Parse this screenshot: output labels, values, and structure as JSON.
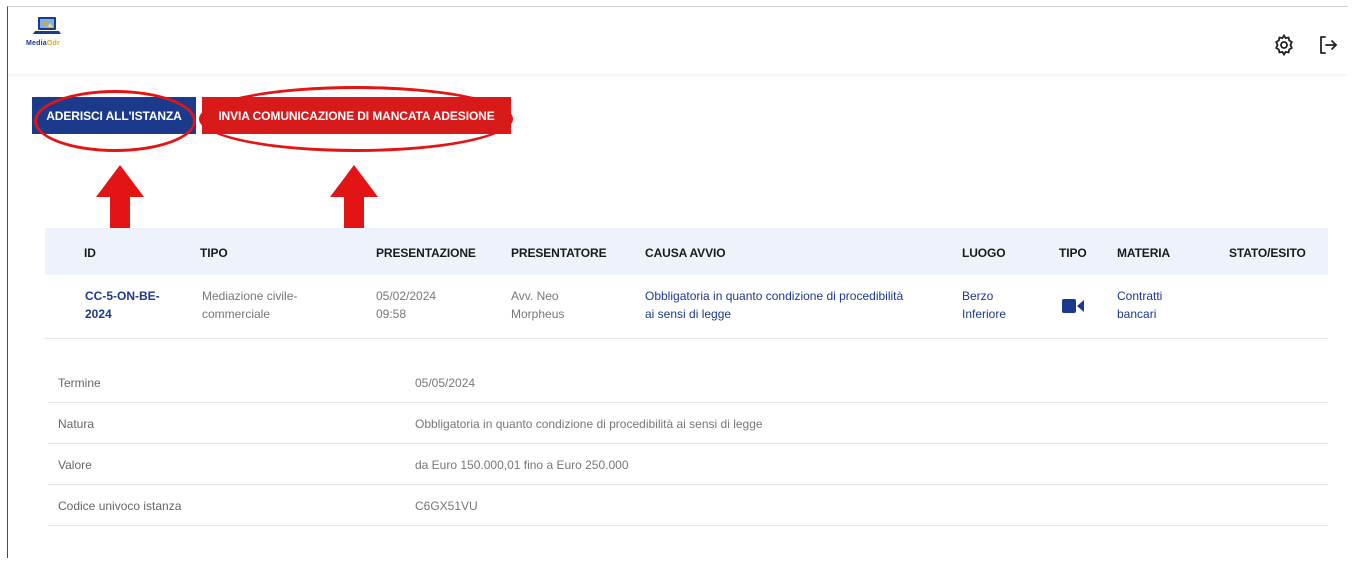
{
  "header": {
    "logo_text_main": "Media",
    "logo_text_accent": "Odr"
  },
  "actions": {
    "adhere_label": "ADERISCI ALL'ISTANZA",
    "decline_label": "INVIA COMUNICAZIONE DI MANCATA ADESIONE"
  },
  "table": {
    "headers": [
      "ID",
      "TIPO",
      "PRESENTAZIONE",
      "PRESENTATORE",
      "CAUSA AVVIO",
      "LUOGO",
      "TIPO",
      "MATERIA",
      "STATO/ESITO"
    ],
    "row": {
      "id_line1": "CC-5-ON-BE-",
      "id_line2": "2024",
      "tipo_line1": "Mediazione civile-",
      "tipo_line2": "commerciale",
      "presentazione_line1": "05/02/2024",
      "presentazione_line2": "09:58",
      "presentatore_line1": "Avv. Neo",
      "presentatore_line2": "Morpheus",
      "causa_line1": "Obbligatoria in quanto condizione di procedibilità",
      "causa_line2": "ai sensi di legge",
      "luogo_line1": "Berzo",
      "luogo_line2": "Inferiore",
      "tipo_icon": "video-camera-icon",
      "materia_line1": "Contratti",
      "materia_line2": "bancari",
      "stato": ""
    }
  },
  "details": [
    {
      "label": "Termine",
      "value": "05/05/2024"
    },
    {
      "label": "Natura",
      "value": "Obbligatoria in quanto condizione di procedibilità ai sensi di legge"
    },
    {
      "label": "Valore",
      "value": "da Euro 150.000,01 fino a Euro 250.000"
    },
    {
      "label": "Codice univoco istanza",
      "value": "C6GX51VU"
    }
  ],
  "colors": {
    "primary": "#1c3a8c",
    "danger": "#d71a1a",
    "annotation": "#e21414",
    "header_row_bg": "#eef3fb"
  }
}
